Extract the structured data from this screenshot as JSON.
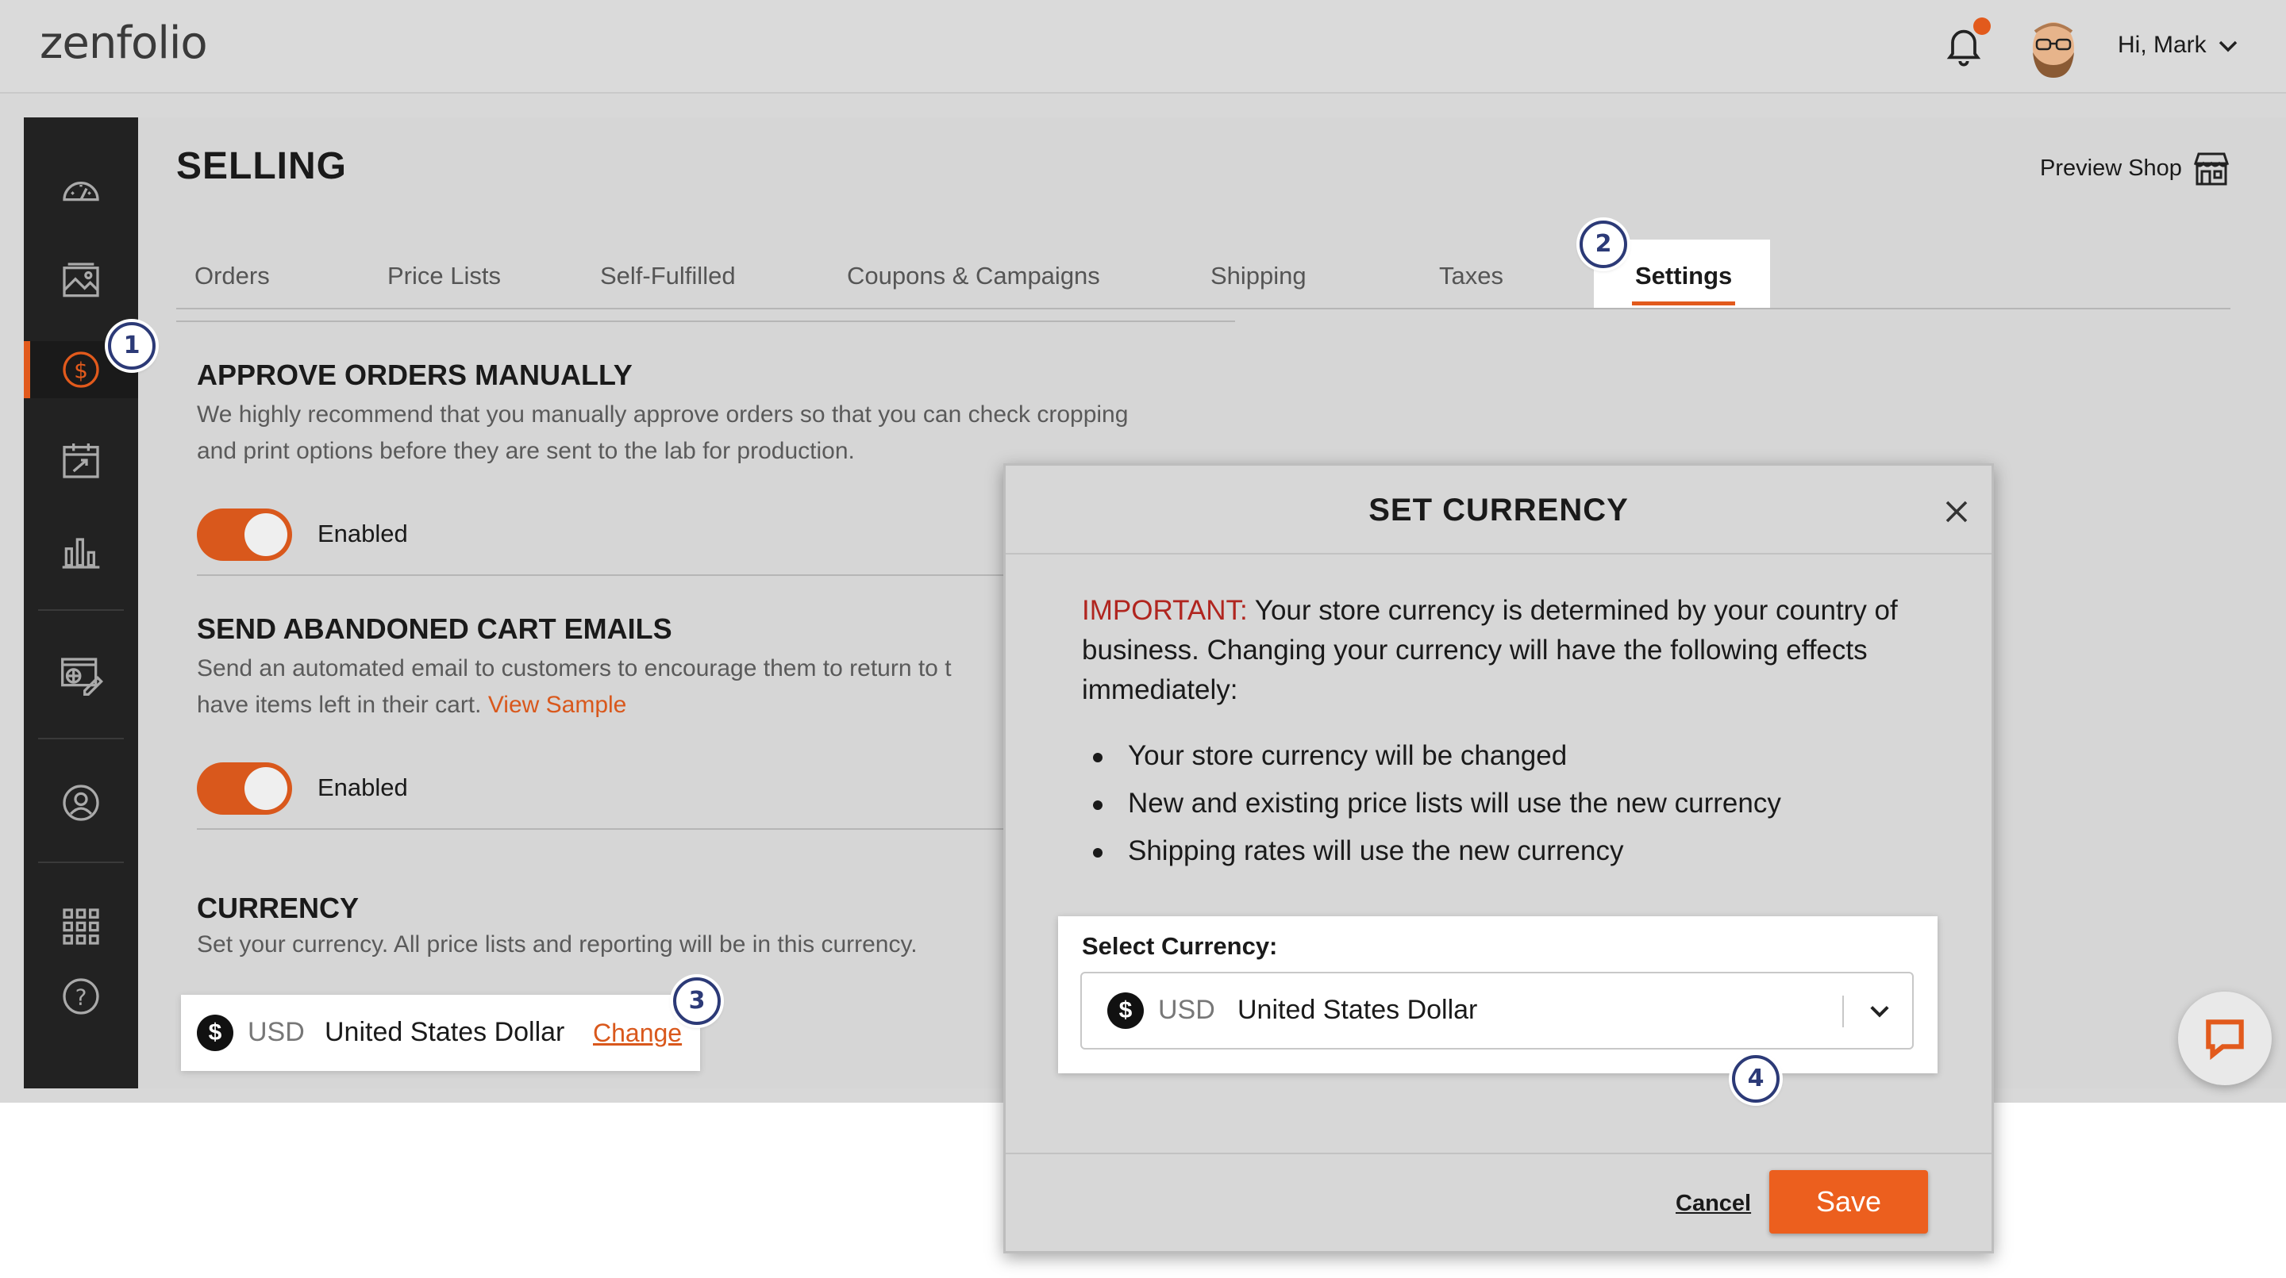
{
  "app": {
    "logo_text": "zenfolio",
    "greeting": "Hi, Mark",
    "accent_color": "#e25a1c"
  },
  "page": {
    "title": "SELLING",
    "preview_shop_label": "Preview Shop"
  },
  "tabs": [
    {
      "label": "Orders"
    },
    {
      "label": "Price Lists"
    },
    {
      "label": "Self-Fulfilled"
    },
    {
      "label": "Coupons & Campaigns"
    },
    {
      "label": "Shipping"
    },
    {
      "label": "Taxes"
    },
    {
      "label": "Settings",
      "active": true
    }
  ],
  "sidebar_icons": [
    "dashboard-gauge-icon",
    "gallery-image-icon",
    "selling-dollar-icon",
    "calendar-booking-icon",
    "analytics-bar-chart-icon",
    "website-design-icon",
    "contacts-user-icon",
    "apps-grid-icon",
    "help-question-icon"
  ],
  "sections": {
    "approve": {
      "title": "APPROVE ORDERS MANUALLY",
      "desc_line1": "We highly recommend that you manually approve orders so that you can check cropping",
      "desc_line2": "and print options before they are sent to the lab for production.",
      "toggle_label": "Enabled"
    },
    "abandoned": {
      "title": "SEND ABANDONED CART EMAILS",
      "desc_line1": "Send an automated email to customers to encourage them to return to t",
      "desc_line2": "have items left in their cart.",
      "link": "View Sample",
      "toggle_label": "Enabled"
    },
    "currency": {
      "title": "CURRENCY",
      "desc": "Set your currency. All price lists and reporting will be in this currency.",
      "symbol": "$",
      "code": "USD",
      "name": "United States Dollar",
      "change_label": "Change"
    }
  },
  "modal": {
    "title": "SET CURRENCY",
    "important_label": "IMPORTANT:",
    "warning_text": " Your store currency is determined by your country of business. Changing your currency will have the following effects immediately:",
    "bullets": [
      "Your store currency will be changed",
      "New and existing price lists will use the new currency",
      "Shipping rates will use the new currency"
    ],
    "select_label": "Select Currency:",
    "selected": {
      "symbol": "$",
      "code": "USD",
      "name": "United States Dollar"
    },
    "cancel_label": "Cancel",
    "save_label": "Save",
    "save_color": "#ec5f1e"
  },
  "steps": [
    "1",
    "2",
    "3",
    "4"
  ]
}
